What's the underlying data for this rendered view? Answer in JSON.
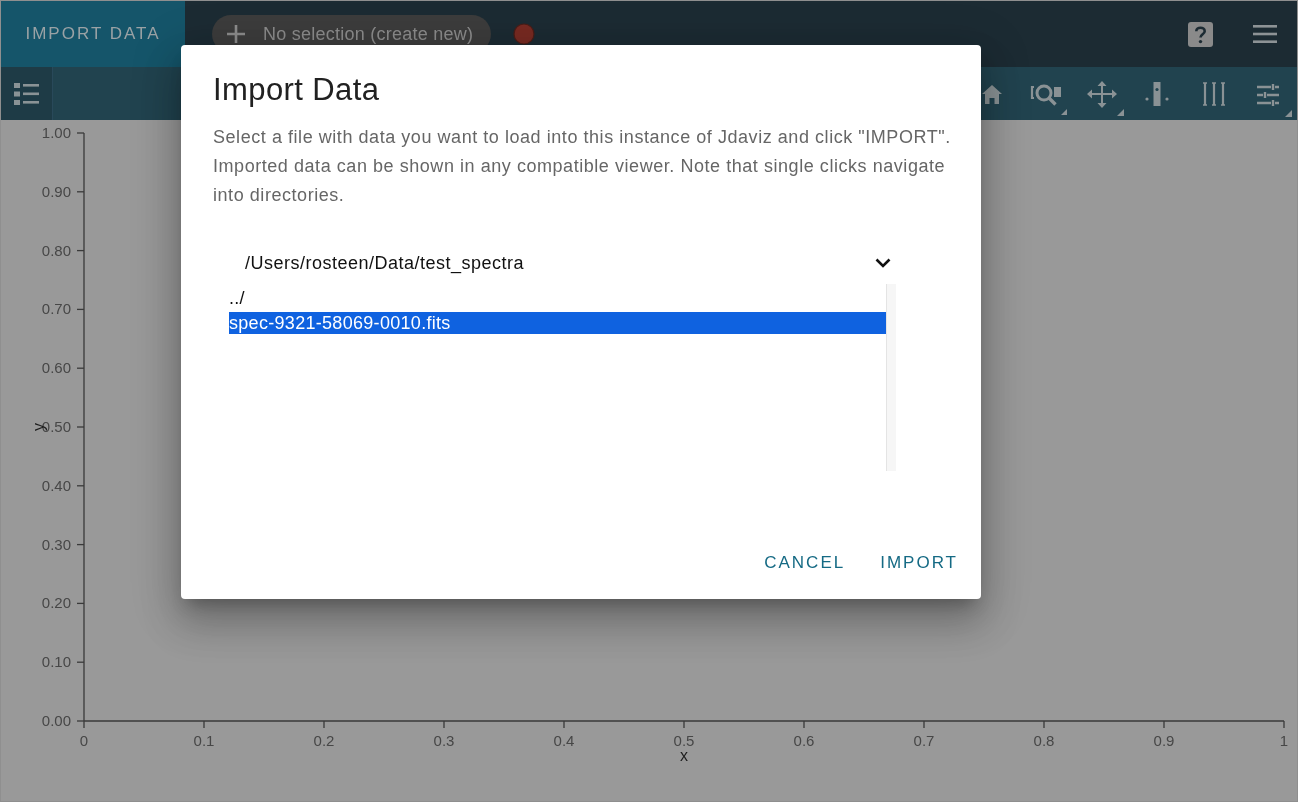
{
  "app_bar": {
    "import_button": {
      "label": "IMPORT DATA"
    },
    "data_menu": {
      "label": "No selection (create new)"
    }
  },
  "plot": {
    "chart_data": {
      "type": "line",
      "xlabel": "x",
      "ylabel": "y",
      "xlim": [
        0,
        1
      ],
      "ylim": [
        0,
        1
      ],
      "xticks": [
        0,
        0.1,
        0.2,
        0.3,
        0.4,
        0.5,
        0.6,
        0.7,
        0.8,
        0.9,
        1
      ],
      "yticks": [
        {
          "value": 0,
          "label": "0.00"
        },
        {
          "value": 0.1,
          "label": "0.10"
        },
        {
          "value": 0.2,
          "label": "0.20"
        },
        {
          "value": 0.3,
          "label": "0.30"
        },
        {
          "value": 0.4,
          "label": "0.40"
        },
        {
          "value": 0.5,
          "label": "0.50"
        },
        {
          "value": 0.6,
          "label": "0.60"
        },
        {
          "value": 0.7,
          "label": "0.70"
        },
        {
          "value": 0.8,
          "label": "0.80"
        },
        {
          "value": 0.9,
          "label": "0.90"
        },
        {
          "value": 1,
          "label": "1.00"
        }
      ]
    }
  },
  "dialog": {
    "title": "Import Data",
    "description": "Select a file with data you want to load into this instance of Jdaviz and click \"IMPORT\". Imported data can be shown in any compatible viewer. Note that single clicks navigate into directories.",
    "folder": {
      "value": "/Users/rosteen/Data/test_spectra"
    },
    "files": [
      {
        "name": "../",
        "selected": false
      },
      {
        "name": "spec-9321-58069-0010.fits",
        "selected": true
      }
    ],
    "buttons": [
      "CANCEL",
      "IMPORT"
    ]
  }
}
